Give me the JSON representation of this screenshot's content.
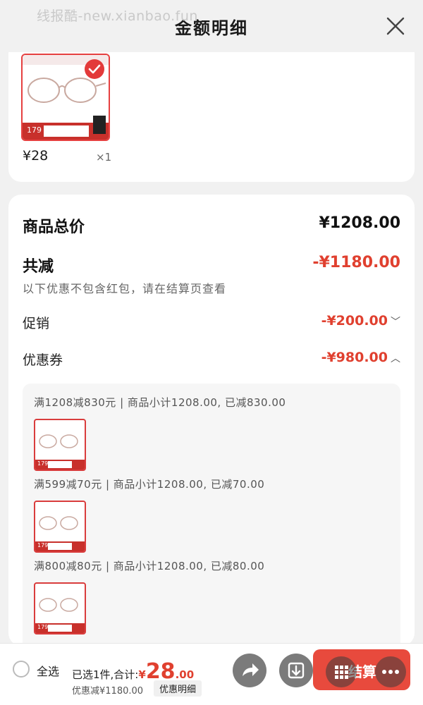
{
  "watermark": "线报酷-new.xianbao.fun",
  "header": {
    "title": "金额明细"
  },
  "product": {
    "price": "¥28",
    "qty": "×1",
    "thumb_price": "179"
  },
  "summary": {
    "total_label": "商品总价",
    "total_value": "¥1208.00",
    "reduce_label": "共减",
    "reduce_value": "-¥1180.00",
    "note": "以下优惠不包含红包，请在结算页查看",
    "promo_label": "促销",
    "promo_value": "-¥200.00",
    "coupon_label": "优惠券",
    "coupon_value": "-¥980.00"
  },
  "coupons": [
    {
      "text": "满1208减830元 | 商品小计1208.00, 已减830.00",
      "thumb_price": "179"
    },
    {
      "text": "满599减70元 | 商品小计1208.00, 已减70.00",
      "thumb_price": "179"
    },
    {
      "text": "满800减80元 | 商品小计1208.00, 已减80.00",
      "thumb_price": "179"
    }
  ],
  "bottom": {
    "select_all": "全选",
    "selected_prefix": "已选1件,合计:",
    "price_symbol": "¥",
    "price_int": "28",
    "price_dec": ".00",
    "discount": "优惠减¥1180.00",
    "detail_btn": "优惠明细",
    "checkout": "结算"
  },
  "colors": {
    "accent": "#e0402f",
    "checkout": "#e84a3d"
  }
}
